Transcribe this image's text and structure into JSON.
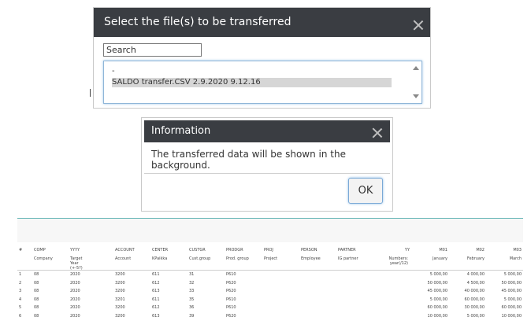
{
  "file_dialog": {
    "title": "Select the file(s) to be transferred",
    "search_placeholder": "Search",
    "items": [
      "-",
      "SALDO transfer.CSV 2.9.2020 9.12.16"
    ]
  },
  "info_dialog": {
    "title": "Information",
    "message": "The transferred data will be shown in the background.",
    "ok_label": "OK"
  },
  "table": {
    "columns": [
      "#",
      "COMP",
      "YYYY",
      "ACCOUNT",
      "CENTER",
      "CUSTGR",
      "PRODGR",
      "PROJ",
      "PERSON",
      "PARTNER",
      "YY",
      "M01",
      "M02",
      "M03"
    ],
    "sublabels": [
      "",
      "Company",
      "Target Year (+-5?)",
      "Account",
      "KPaikka",
      "Cust.group",
      "Prod. group",
      "Project",
      "Employee",
      "IG partner",
      "Numbers: year(/12)",
      "January",
      "February",
      "March"
    ],
    "rows": [
      [
        "1",
        "08",
        "2020",
        "3200",
        "611",
        "31",
        "P610",
        "",
        "",
        "",
        "",
        "5 000,00",
        "4 000,00",
        "5 000,00"
      ],
      [
        "2",
        "08",
        "2020",
        "3200",
        "612",
        "32",
        "P620",
        "",
        "",
        "",
        "",
        "50 000,00",
        "4 500,00",
        "50 000,00"
      ],
      [
        "3",
        "08",
        "2020",
        "3200",
        "613",
        "33",
        "P620",
        "",
        "",
        "",
        "",
        "45 000,00",
        "40 000,00",
        "45 000,00"
      ],
      [
        "4",
        "08",
        "2020",
        "3201",
        "611",
        "35",
        "P610",
        "",
        "",
        "",
        "",
        "5 000,00",
        "60 000,00",
        "5 000,00"
      ],
      [
        "5",
        "08",
        "2020",
        "3200",
        "612",
        "36",
        "P610",
        "",
        "",
        "",
        "",
        "60 000,00",
        "30 000,00",
        "60 000,00"
      ],
      [
        "6",
        "08",
        "2020",
        "3200",
        "613",
        "39",
        "P620",
        "",
        "",
        "",
        "",
        "10 000,00",
        "5 000,00",
        "10 000,00"
      ]
    ]
  }
}
